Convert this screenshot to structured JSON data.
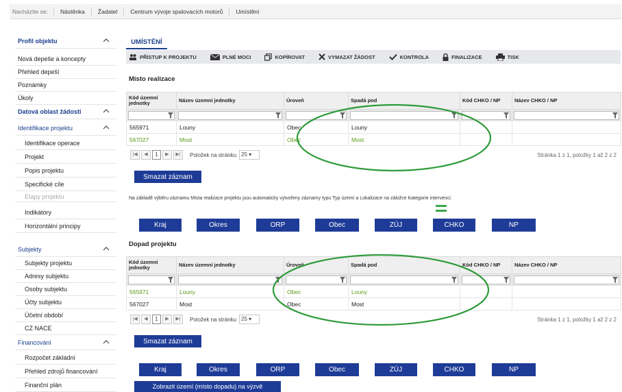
{
  "breadcrumb": {
    "lead": "Nacházíte se:",
    "items": [
      "Nástěnka",
      "Žadatel",
      "Centrum vývoje spalovacích motorů",
      "Umístění"
    ]
  },
  "sidebar": {
    "items": [
      {
        "label": "Profil objektu"
      },
      {
        "label": "Nová depeše a koncepty"
      },
      {
        "label": "Přehled depeší"
      },
      {
        "label": "Poznámky"
      },
      {
        "label": "Úkoly"
      },
      {
        "label": "Datová oblast žádosti"
      },
      {
        "label": "Identifikace projektu"
      },
      {
        "label": "Identifikace operace"
      },
      {
        "label": "Projekt"
      },
      {
        "label": "Popis projektu"
      },
      {
        "label": "Specifické cíle"
      },
      {
        "label": "Etapy projektu"
      },
      {
        "label": "Indikátory"
      },
      {
        "label": "Horizontální principy"
      },
      {
        "label": "Subjekty"
      },
      {
        "label": "Subjekty projektu"
      },
      {
        "label": "Adresy subjektu"
      },
      {
        "label": "Osoby subjektu"
      },
      {
        "label": "Účty subjektu"
      },
      {
        "label": "Účetní období"
      },
      {
        "label": "CZ NACE"
      },
      {
        "label": "Financování"
      },
      {
        "label": "Rozpočet základní"
      },
      {
        "label": "Přehled zdrojů financování"
      },
      {
        "label": "Finanční plán"
      }
    ]
  },
  "tab": {
    "title": "UMÍSTĚNÍ"
  },
  "toolbar": {
    "items": [
      "PŘÍSTUP K PROJEKTU",
      "PLNÉ MOCI",
      "KOPÍROVAT",
      "VYMAZAT ŽÁDOST",
      "KONTROLA",
      "FINALIZACE",
      "TISK"
    ]
  },
  "columns": [
    "Kód územní jednotky",
    "Název územní jednotky",
    "Úroveň",
    "Spadá pod",
    "Kód CHKO / NP",
    "Název CHKO / NP"
  ],
  "misto": {
    "title": "Místo realizace",
    "rows": [
      [
        "565971",
        "Louny",
        "Obec",
        "Louny",
        "",
        ""
      ],
      [
        "567027",
        "Most",
        "Obec",
        "Most",
        "",
        ""
      ]
    ],
    "pager": {
      "page": "1",
      "per_page_label": "Položek na stránku",
      "per_page": "25",
      "info": "Stránka 1 z 1, položky 1 až 2 z 2"
    },
    "delete_label": "Smazat záznam",
    "note": "Na základě výběru záznamu Místa realizace projektu jsou automaticky vytvořeny záznamy typu Typ území a Lokalizace na záložce Kategorie intervencí."
  },
  "level_buttons": [
    "Kraj",
    "Okres",
    "ORP",
    "Obec",
    "ZÚJ",
    "CHKO",
    "NP"
  ],
  "dopad": {
    "title": "Dopad projektu",
    "rows": [
      [
        "565971",
        "Louny",
        "Obec",
        "Louny",
        "",
        ""
      ],
      [
        "567027",
        "Most",
        "Obec",
        "Most",
        "",
        ""
      ]
    ],
    "pager": {
      "page": "1",
      "per_page_label": "Položek na stránku",
      "per_page": "25",
      "info": "Stránka 1 z 1, položky 1 až 2 z 2"
    },
    "delete_label": "Smazat záznam",
    "show_label": "Zobrazit území (místo dopadu) na výzvě"
  },
  "colors": {
    "accent": "#1e3c97",
    "highlight_green": "#2e9a3a",
    "row_green": "#5a9a1c"
  }
}
